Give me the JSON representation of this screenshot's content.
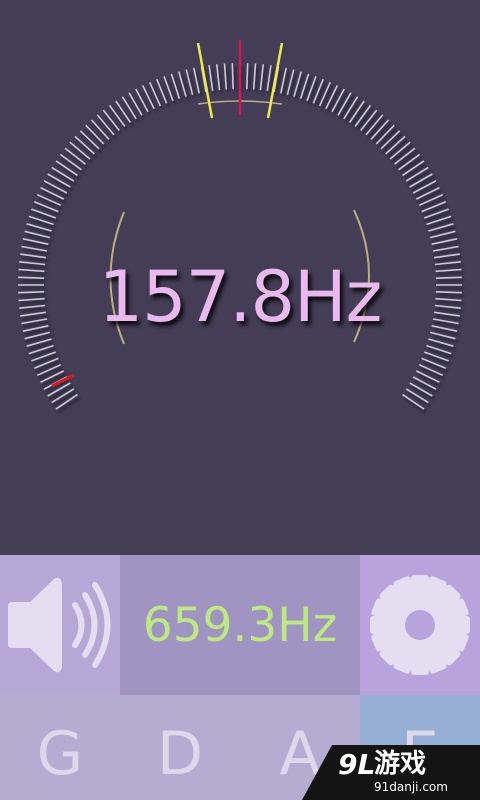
{
  "tuner": {
    "current_frequency": "157.8Hz",
    "needle_color": "#d8154f",
    "tolerance_mark_color": "#f1e94a",
    "bracket_color": "#b9b07c",
    "tick_color": "#c9c9db",
    "low_end_mark_color": "#e3141c"
  },
  "controls": {
    "sound_icon": "speaker-icon",
    "target_frequency": "659.3Hz",
    "settings_icon": "gear-icon"
  },
  "strings": [
    {
      "note": "G"
    },
    {
      "note": "D"
    },
    {
      "note": "A"
    },
    {
      "note": "E",
      "selected": true
    }
  ],
  "watermark": {
    "logo": "9L",
    "brand": "游戏",
    "domain": "91danji.com"
  }
}
